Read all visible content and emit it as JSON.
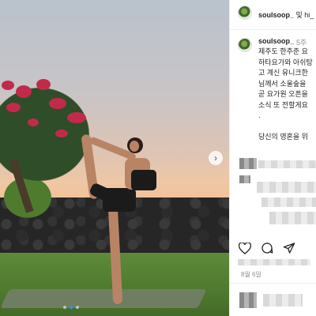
{
  "post": {
    "photo_dots": {
      "count": 3,
      "active_index": 1
    },
    "next_symbol": "›"
  },
  "panel": {
    "header": {
      "username": "soulsoop_",
      "and_text": " 및 hi_"
    },
    "caption": {
      "username": "soulsoop_",
      "time": "5주",
      "lines": [
        "제주도 한주준 요",
        "하타요가와 아쉬탕",
        "고 계신 유니크한",
        "님께서 소울숲을",
        "곧 요가원 오픈을",
        "소식 또 전할게요",
        ".",
        "",
        "당신의 영혼을 위"
      ]
    },
    "actions": [
      "heart-icon",
      "comment-icon",
      "share-icon"
    ],
    "date": "8월 6일"
  },
  "colors": {
    "accent_dot": "#3a8ee6",
    "text_primary": "#262626",
    "text_secondary": "#8e8e8e"
  }
}
